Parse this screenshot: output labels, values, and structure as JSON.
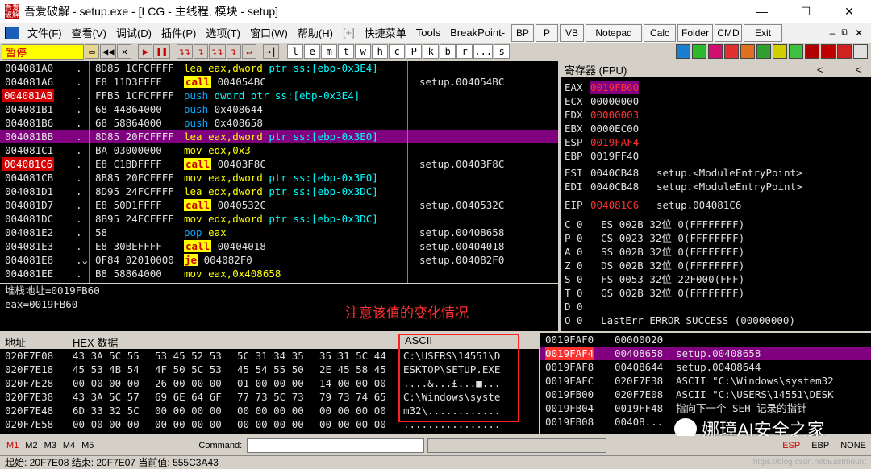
{
  "window": {
    "title": "吾爱破解 - setup.exe - [LCG - 主线程, 模块 - setup]",
    "icon_text": "吾爱破解",
    "controls": [
      "—",
      "☐",
      "✕"
    ]
  },
  "menu": {
    "items": [
      "文件(F)",
      "查看(V)",
      "调试(D)",
      "插件(P)",
      "选项(T)",
      "窗口(W)",
      "帮助(H)",
      "[+]",
      "快捷菜单",
      "Tools",
      "BreakPoint-"
    ],
    "plugin_buttons": [
      "BP",
      "P",
      "VB",
      "Notepad",
      "Calc",
      "Folder",
      "CMD",
      "Exit"
    ],
    "right_icons": [
      "–",
      "⧉",
      "✕"
    ]
  },
  "toolbar": {
    "status": "暂停",
    "buttons": [
      "▶",
      "◀◀",
      "✕",
      "▶",
      "❚❚",
      "↴↴",
      "↴",
      "↴↴",
      "↴",
      "↵",
      "→|"
    ],
    "letters": [
      "l",
      "e",
      "m",
      "t",
      "w",
      "h",
      "c",
      "P",
      "k",
      "b",
      "r",
      "...",
      "s"
    ]
  },
  "disasm": [
    {
      "addr": "004081A0",
      "mark": ".",
      "hex": "8D85 1CFCFFFF",
      "asm_tokens": [
        [
          "lea",
          "m-lea"
        ],
        [
          " eax,dword ",
          "t-y"
        ],
        [
          "ptr ss:[ebp-0x3E4]",
          "t-sq"
        ]
      ],
      "comment": ""
    },
    {
      "addr": "004081A6",
      "mark": ".",
      "hex": "E8 11D3FFFF",
      "asm_tokens": [
        [
          "call",
          "m-call"
        ],
        [
          " 004054BC",
          "t-w"
        ]
      ],
      "comment": "setup.004054BC"
    },
    {
      "addr": "004081AB",
      "mark": ".",
      "hex": "FFB5 1CFCFFFF",
      "asm_tokens": [
        [
          "push",
          "m-push"
        ],
        [
          " dword ptr ss:[ebp-0x3E4]",
          "t-sq"
        ]
      ],
      "comment": "",
      "addr_hl": true
    },
    {
      "addr": "004081B1",
      "mark": ".",
      "hex": "68 44864000",
      "asm_tokens": [
        [
          "push",
          "m-push"
        ],
        [
          " 0x408644",
          "t-w"
        ]
      ],
      "comment": ""
    },
    {
      "addr": "004081B6",
      "mark": ".",
      "hex": "68 58864000",
      "asm_tokens": [
        [
          "push",
          "m-push"
        ],
        [
          " 0x408658",
          "t-w"
        ]
      ],
      "comment": ""
    },
    {
      "addr": "004081BB",
      "mark": ".",
      "hex": "8D85 20FCFFFF",
      "asm_tokens": [
        [
          "lea",
          "m-lea"
        ],
        [
          " eax,dword ",
          "t-y"
        ],
        [
          "ptr ss:[ebp-0x3E0]",
          "t-sq"
        ]
      ],
      "comment": "",
      "selected": true
    },
    {
      "addr": "004081C1",
      "mark": ".",
      "hex": "BA 03000000",
      "asm_tokens": [
        [
          "mov",
          "m-mov"
        ],
        [
          " edx,",
          "t-y"
        ],
        [
          "0x3",
          "t-y"
        ]
      ],
      "comment": ""
    },
    {
      "addr": "004081C6",
      "mark": ".",
      "hex": "E8 C1BDFFFF",
      "asm_tokens": [
        [
          "call",
          "m-call"
        ],
        [
          " 00403F8C",
          "t-w"
        ]
      ],
      "comment": "setup.00403F8C",
      "addr_hl": true
    },
    {
      "addr": "004081CB",
      "mark": ".",
      "hex": "8B85 20FCFFFF",
      "asm_tokens": [
        [
          "mov",
          "m-mov"
        ],
        [
          " eax,dword ",
          "t-y"
        ],
        [
          "ptr ss:[ebp-0x3E0]",
          "t-sq"
        ]
      ],
      "comment": ""
    },
    {
      "addr": "004081D1",
      "mark": ".",
      "hex": "8D95 24FCFFFF",
      "asm_tokens": [
        [
          "lea",
          "m-lea"
        ],
        [
          " edx,dword ",
          "t-y"
        ],
        [
          "ptr ss:[ebp-0x3DC]",
          "t-sq"
        ]
      ],
      "comment": ""
    },
    {
      "addr": "004081D7",
      "mark": ".",
      "hex": "E8 50D1FFFF",
      "asm_tokens": [
        [
          "call",
          "m-call"
        ],
        [
          " 0040532C",
          "t-w"
        ]
      ],
      "comment": "setup.0040532C"
    },
    {
      "addr": "004081DC",
      "mark": ".",
      "hex": "8B95 24FCFFFF",
      "asm_tokens": [
        [
          "mov",
          "m-mov"
        ],
        [
          " edx,dword ",
          "t-y"
        ],
        [
          "ptr ss:[ebp-0x3DC]",
          "t-sq"
        ]
      ],
      "comment": ""
    },
    {
      "addr": "004081E2",
      "mark": ".",
      "hex": "58",
      "asm_tokens": [
        [
          "pop",
          "m-pop"
        ],
        [
          " eax",
          "t-y"
        ]
      ],
      "comment": "setup.00408658"
    },
    {
      "addr": "004081E3",
      "mark": ".",
      "hex": "E8 30BEFFFF",
      "asm_tokens": [
        [
          "call",
          "m-call"
        ],
        [
          " 00404018",
          "t-w"
        ]
      ],
      "comment": "setup.00404018"
    },
    {
      "addr": "004081E8",
      "mark": ".⌄",
      "hex": "0F84 02010000",
      "asm_tokens": [
        [
          "je",
          "m-je"
        ],
        [
          " 004082F0",
          "t-w"
        ]
      ],
      "comment": "setup.004082F0"
    },
    {
      "addr": "004081EE",
      "mark": ".",
      "hex": "B8 58864000",
      "asm_tokens": [
        [
          "mov",
          "m-mov"
        ],
        [
          " eax,0x408658",
          "t-y"
        ]
      ],
      "comment": ""
    }
  ],
  "info": {
    "line1": "堆栈地址=0019FB60",
    "line2": "eax=0019FB60",
    "note": "注意该值的变化情况"
  },
  "registers": {
    "header": "寄存器 (FPU)",
    "regs": [
      {
        "name": "EAX",
        "value": "0019FB60",
        "style": "box",
        "desc": ""
      },
      {
        "name": "ECX",
        "value": "00000000",
        "style": "",
        "desc": ""
      },
      {
        "name": "EDX",
        "value": "00000003",
        "style": "red",
        "desc": ""
      },
      {
        "name": "EBX",
        "value": "0000EC00",
        "style": "",
        "desc": ""
      },
      {
        "name": "ESP",
        "value": "0019FAF4",
        "style": "red",
        "desc": ""
      },
      {
        "name": "EBP",
        "value": "0019FF40",
        "style": "",
        "desc": ""
      },
      {
        "name": "ESI",
        "value": "0040CB48",
        "style": "",
        "desc": "setup.<ModuleEntryPoint>"
      },
      {
        "name": "EDI",
        "value": "0040CB48",
        "style": "",
        "desc": "setup.<ModuleEntryPoint>"
      },
      {
        "name": "EIP",
        "value": "004081C6",
        "style": "red",
        "desc": "setup.004081C6"
      }
    ],
    "flags": [
      "C 0   ES 002B 32位 0(FFFFFFFF)",
      "P 0   CS 0023 32位 0(FFFFFFFF)",
      "A 0   SS 002B 32位 0(FFFFFFFF)",
      "Z 0   DS 002B 32位 0(FFFFFFFF)",
      "S 0   FS 0053 32位 22F000(FFF)",
      "T 0   GS 002B 32位 0(FFFFFFFF)",
      "D 0",
      "O 0   LastErr ERROR_SUCCESS (00000000)"
    ]
  },
  "dump": {
    "col_addr": "地址",
    "col_hex": "HEX 数据",
    "col_ascii": "ASCII",
    "rows": [
      {
        "addr": "020F7E08",
        "hex1": "43 3A 5C 55",
        "hex2": "53 45 52 53",
        "hex3": "5C 31 34 35",
        "hex4": "35 31 5C 44",
        "ascii": "C:\\USERS\\14551\\D"
      },
      {
        "addr": "020F7E18",
        "hex1": "45 53 4B 54",
        "hex2": "4F 50 5C 53",
        "hex3": "45 54 55 50",
        "hex4": "2E 45 58 45",
        "ascii": "ESKTOP\\SETUP.EXE"
      },
      {
        "addr": "020F7E28",
        "hex1": "00 00 00 00",
        "hex2": "26 00 00 00",
        "hex3": "01 00 00 00",
        "hex4": "14 00 00 00",
        "ascii": "....&...£...■..."
      },
      {
        "addr": "020F7E38",
        "hex1": "43 3A 5C 57",
        "hex2": "69 6E 64 6F",
        "hex3": "77 73 5C 73",
        "hex4": "79 73 74 65",
        "ascii": "C:\\Windows\\syste"
      },
      {
        "addr": "020F7E48",
        "hex1": "6D 33 32 5C",
        "hex2": "00 00 00 00",
        "hex3": "00 00 00 00",
        "hex4": "00 00 00 00",
        "ascii": "m32\\............"
      },
      {
        "addr": "020F7E58",
        "hex1": "00 00 00 00",
        "hex2": "00 00 00 00",
        "hex3": "00 00 00 00",
        "hex4": "00 00 00 00",
        "ascii": "................"
      }
    ]
  },
  "stack": {
    "rows": [
      {
        "addr": "0019FAF0",
        "val": "00000020",
        "cmt": "",
        "selected": false
      },
      {
        "addr": "0019FAF4",
        "val": "00408658",
        "cmt": "setup.00408658",
        "selected": true
      },
      {
        "addr": "0019FAF8",
        "val": "00408644",
        "cmt": "setup.00408644",
        "selected": false
      },
      {
        "addr": "0019FAFC",
        "val": "020F7E38",
        "cmt": "ASCII \"C:\\Windows\\system32",
        "selected": false
      },
      {
        "addr": "0019FB00",
        "val": "020F7E08",
        "cmt": "ASCII \"C:\\USERS\\14551\\DESK",
        "selected": false
      },
      {
        "addr": "0019FB04",
        "val": "0019FF48",
        "cmt": "指向下一个 SEH 记录的指针",
        "selected": false
      },
      {
        "addr": "0019FB08",
        "val": "00408...",
        "cmt": "",
        "selected": false
      }
    ]
  },
  "watermark": "娜璋AI安全之家",
  "cmdbar": {
    "tabs": [
      "M1",
      "M2",
      "M3",
      "M4",
      "M5"
    ],
    "label": "Command:",
    "right": [
      "ESP",
      "EBP",
      "NONE"
    ]
  },
  "status": {
    "text": "起始: 20F7E08 结束: 20F7E07 当前值: 555C3A43",
    "url": "https://blog.csdn.net/Eastmount"
  }
}
